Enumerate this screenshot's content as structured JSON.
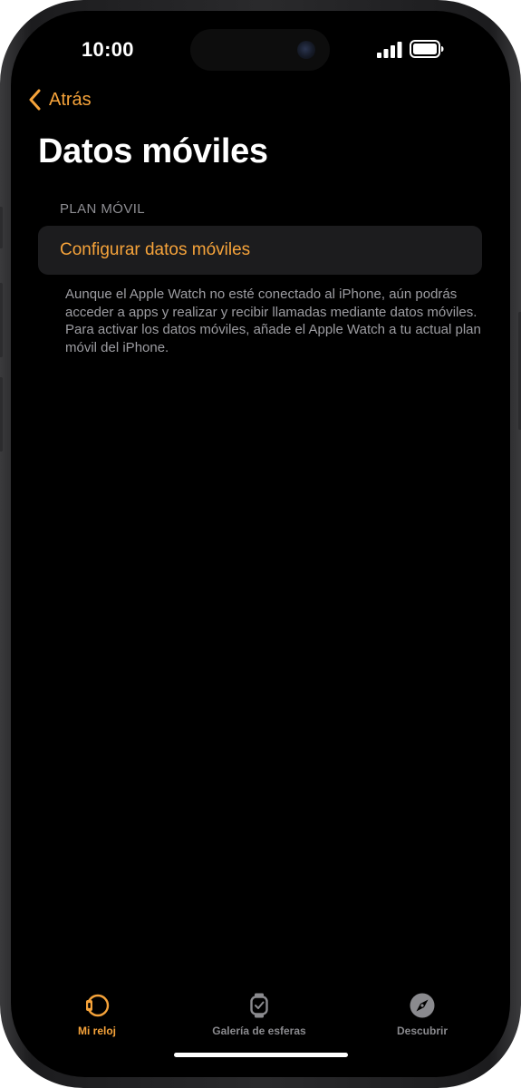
{
  "status_bar": {
    "time": "10:00"
  },
  "nav": {
    "back_label": "Atrás"
  },
  "page": {
    "title": "Datos móviles",
    "section_header": "PLAN MÓVIL",
    "configure_label": "Configurar datos móviles",
    "footer": "Aunque el Apple Watch no esté conectado al iPhone, aún podrás acceder a apps y realizar y recibir llamadas mediante datos móviles. Para activar los datos móviles, añade el Apple Watch a tu actual plan móvil del iPhone."
  },
  "tab_bar": {
    "tabs": [
      {
        "label": "Mi reloj",
        "icon": "watch-face-icon",
        "active": true
      },
      {
        "label": "Galería de esferas",
        "icon": "watch-icon",
        "active": false
      },
      {
        "label": "Descubrir",
        "icon": "compass-icon",
        "active": false
      }
    ]
  },
  "colors": {
    "accent": "#f6a33a",
    "background": "#000000",
    "cell_background": "#1c1c1e",
    "secondary_text": "#8e8e93"
  }
}
